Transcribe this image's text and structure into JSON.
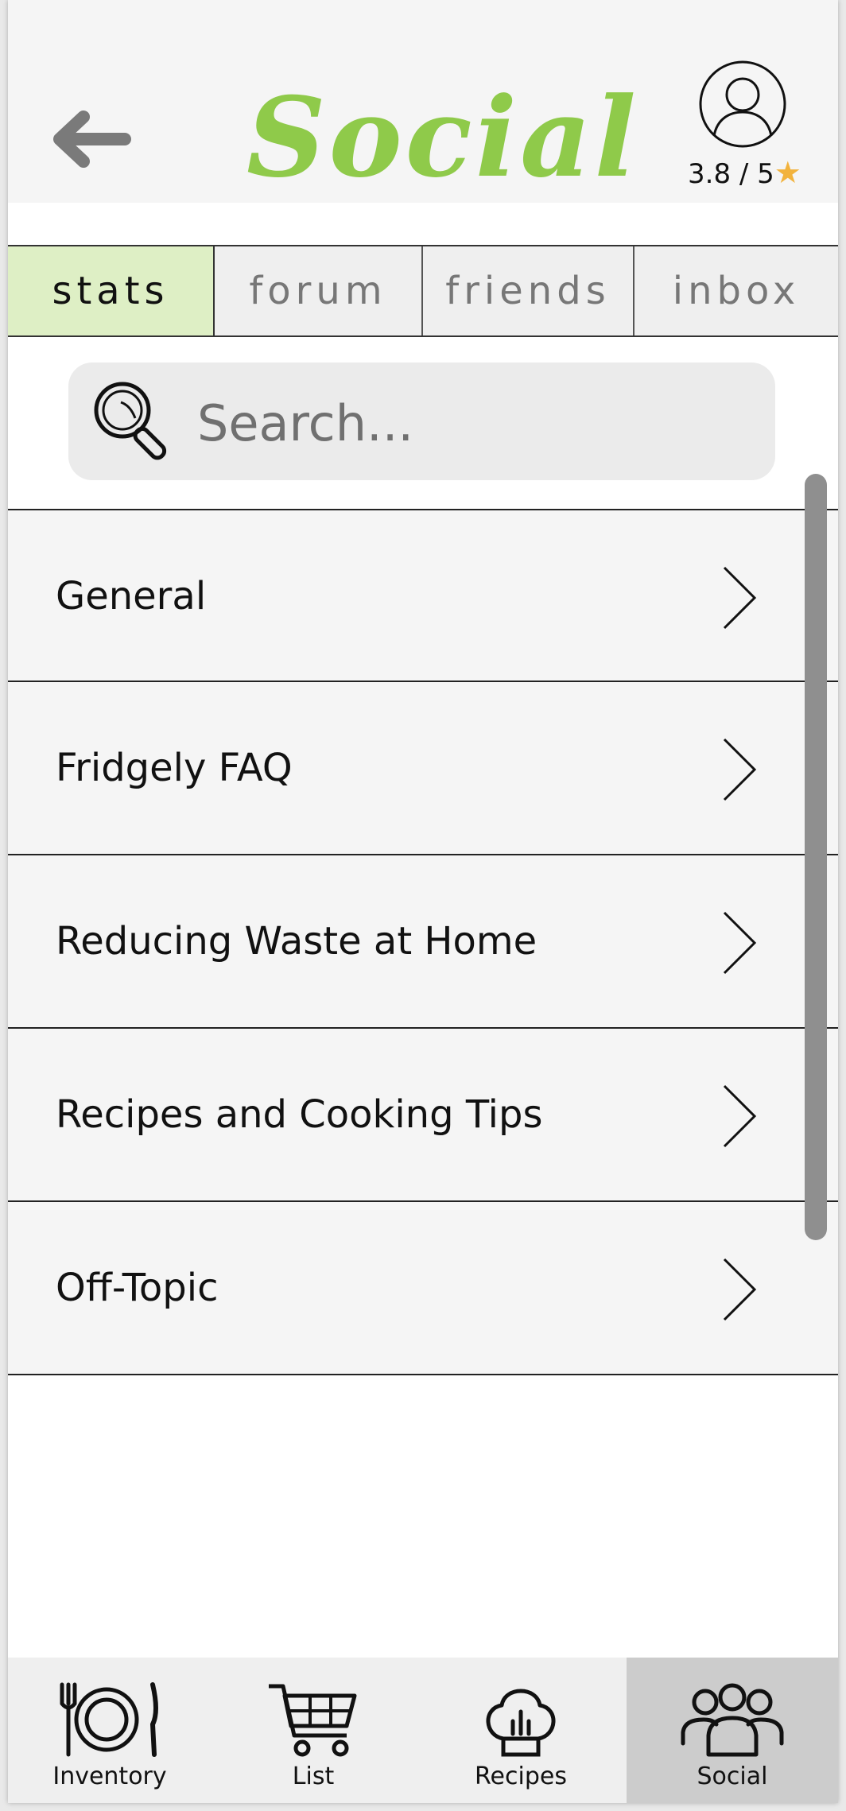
{
  "header": {
    "title": "Social",
    "rating": "3.8 / 5",
    "rating_star": "★",
    "title_color": "#8fca4a"
  },
  "tabs": [
    {
      "label": "stats",
      "active": true
    },
    {
      "label": "forum",
      "active": false
    },
    {
      "label": "friends",
      "active": false
    },
    {
      "label": "inbox",
      "active": false
    }
  ],
  "search": {
    "placeholder": "Search..."
  },
  "topics": [
    {
      "label": "General"
    },
    {
      "label": "Fridgely FAQ"
    },
    {
      "label": "Reducing Waste at Home"
    },
    {
      "label": "Recipes and Cooking Tips"
    },
    {
      "label": "Off-Topic"
    }
  ],
  "bottom_nav": [
    {
      "label": "Inventory",
      "icon": "plate-cutlery-icon"
    },
    {
      "label": "List",
      "icon": "cart-icon"
    },
    {
      "label": "Recipes",
      "icon": "chef-hat-icon"
    },
    {
      "label": "Social",
      "icon": "group-icon",
      "active": true
    }
  ]
}
